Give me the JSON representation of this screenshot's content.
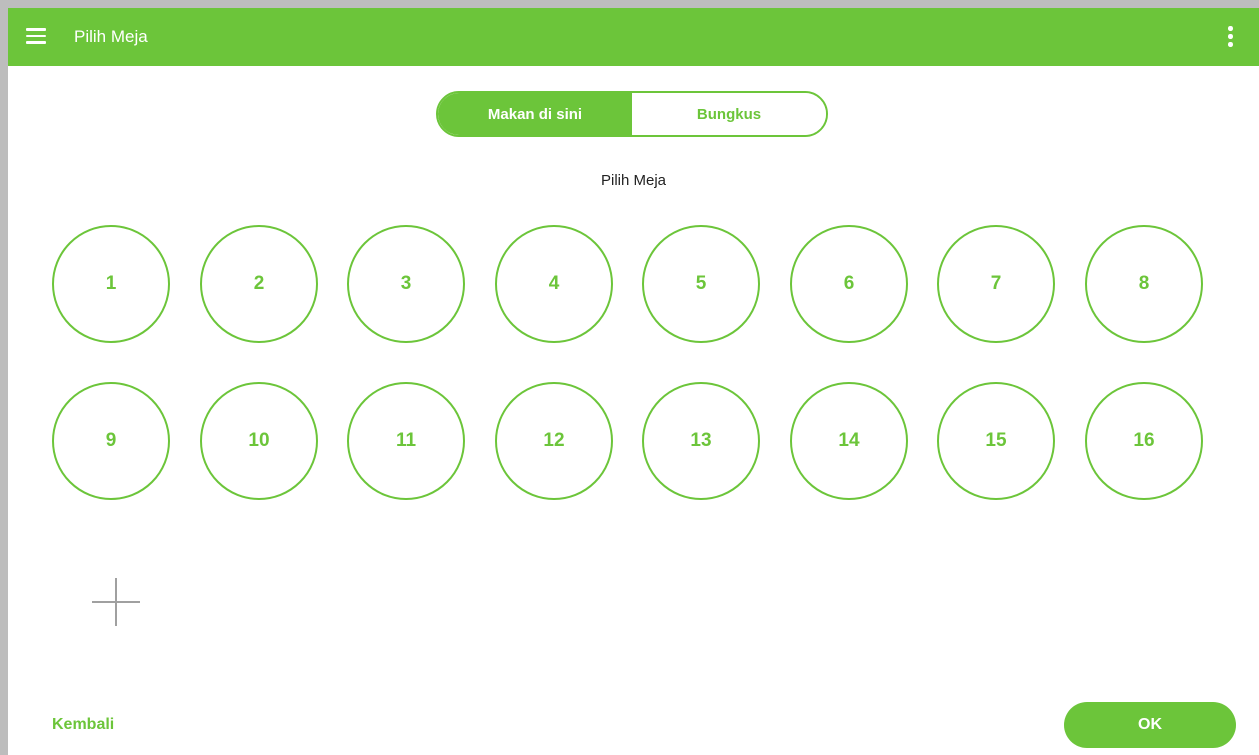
{
  "header": {
    "title": "Pilih Meja",
    "menu_icon": "hamburger-menu-icon",
    "more_icon": "more-vertical-icon"
  },
  "order_type": {
    "options": [
      {
        "label": "Makan di sini",
        "selected": true
      },
      {
        "label": "Bungkus",
        "selected": false
      }
    ]
  },
  "section_label": "Pilih Meja",
  "tables": [
    "1",
    "2",
    "3",
    "4",
    "5",
    "6",
    "7",
    "8",
    "9",
    "10",
    "11",
    "12",
    "13",
    "14",
    "15",
    "16"
  ],
  "add_table_icon": "plus-icon",
  "footer": {
    "back_label": "Kembali",
    "ok_label": "OK"
  },
  "colors": {
    "accent": "#6cc53a",
    "background": "#ffffff",
    "text": "#222222",
    "muted_icon": "#a0a0a0"
  }
}
